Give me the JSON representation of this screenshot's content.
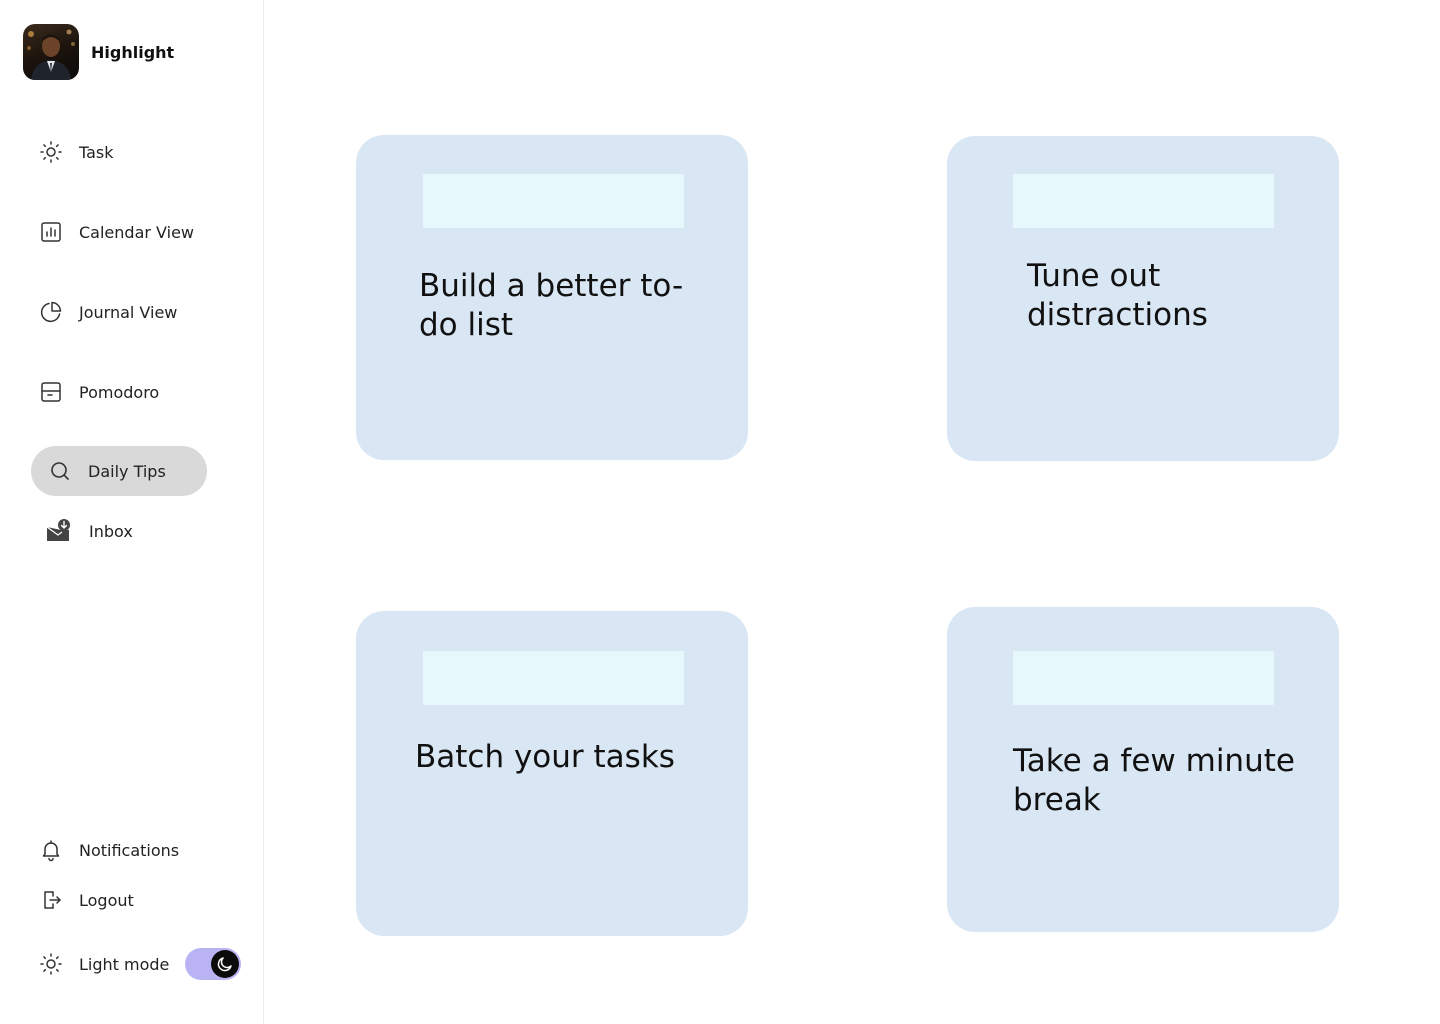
{
  "app": {
    "name": "Highlight"
  },
  "sidebar": {
    "items": [
      {
        "label": "Task",
        "icon": "sun-icon"
      },
      {
        "label": "Calendar View",
        "icon": "bar-chart-icon"
      },
      {
        "label": "Journal View",
        "icon": "pie-chart-icon"
      },
      {
        "label": "Pomodoro",
        "icon": "box-icon"
      },
      {
        "label": "Daily Tips",
        "icon": "search-icon",
        "active": true
      },
      {
        "label": "Inbox",
        "icon": "inbox-download-icon"
      }
    ],
    "bottom": [
      {
        "label": "Notifications",
        "icon": "bell-icon"
      },
      {
        "label": "Logout",
        "icon": "logout-icon"
      }
    ],
    "theme": {
      "label": "Light mode",
      "icon": "sun-icon",
      "toggle_on": true,
      "toggle_color": "#b9b3f4"
    }
  },
  "tips": [
    {
      "title": "Build a better to-do list"
    },
    {
      "title": "Tune out distractions"
    },
    {
      "title": "Batch your tasks"
    },
    {
      "title": "Take a few minute break"
    }
  ],
  "colors": {
    "card_bg": "#d9e6f3",
    "card_banner": "#e7f8fc",
    "active_nav_bg": "#d9d9d9"
  }
}
